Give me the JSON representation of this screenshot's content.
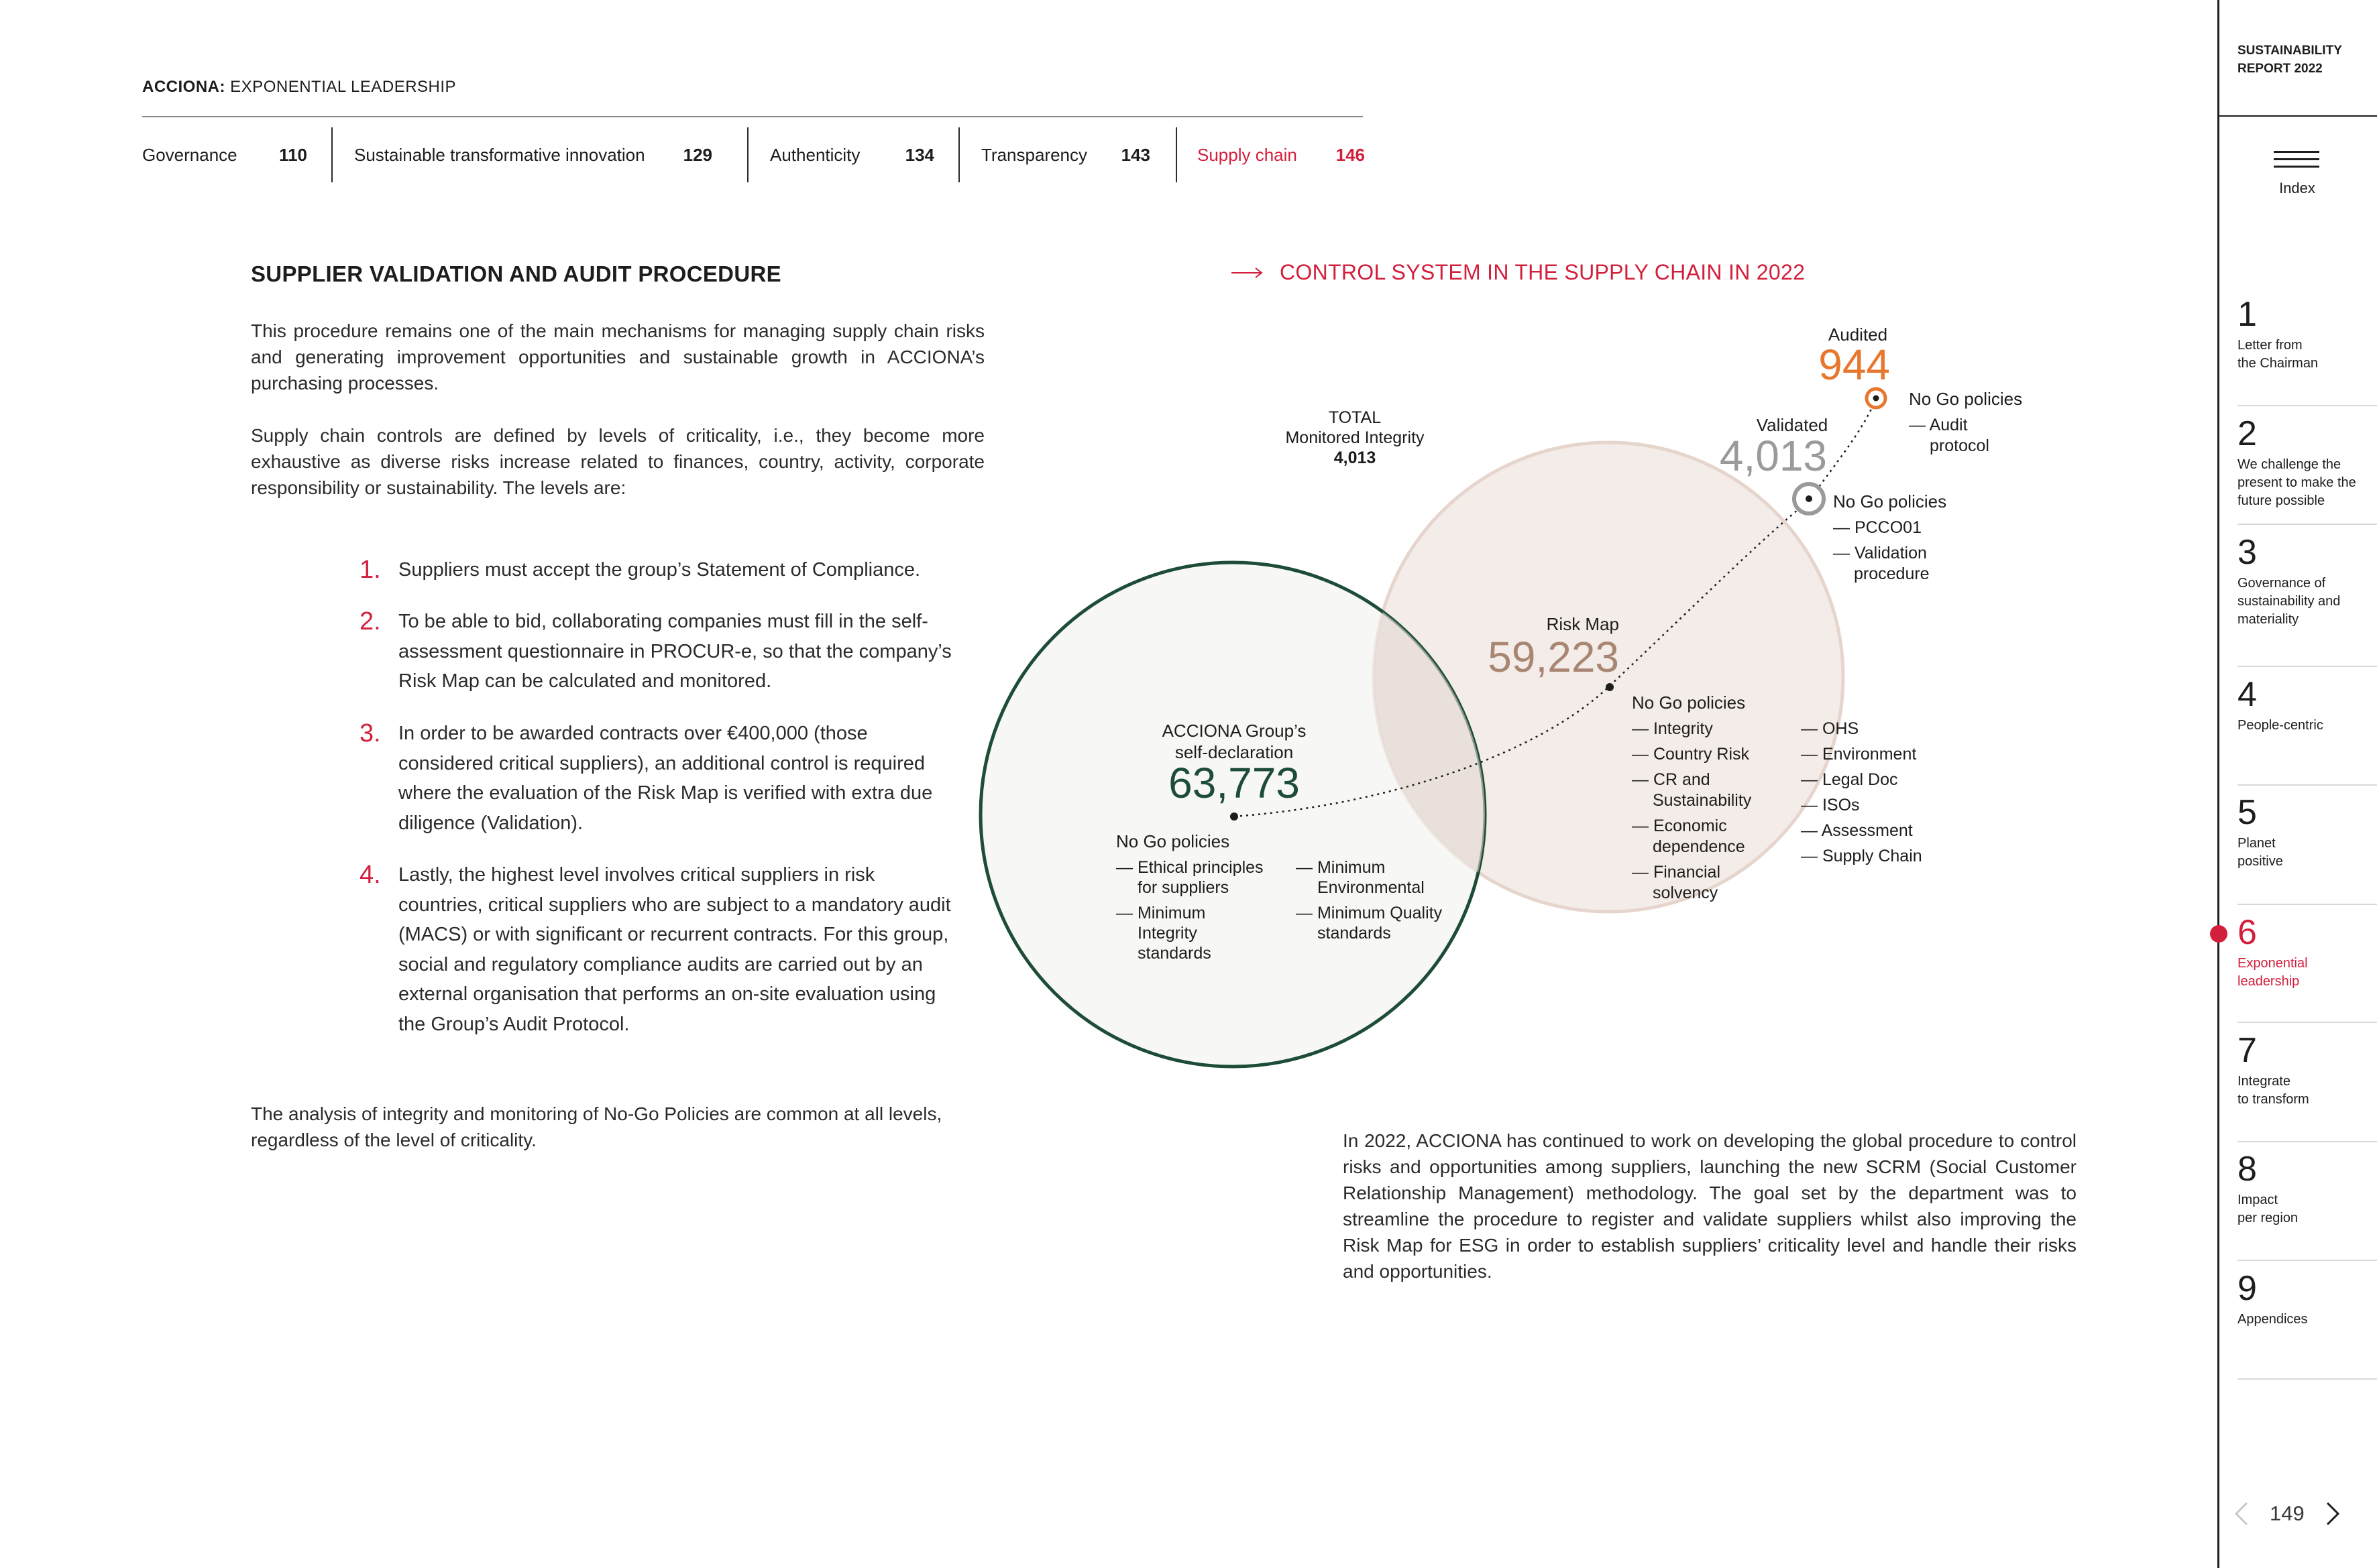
{
  "header": {
    "brand_bold": "ACCIONA:",
    "brand_rest": " EXPONENTIAL LEADERSHIP",
    "nav": [
      {
        "label": "Governance",
        "page": "110"
      },
      {
        "label": "Sustainable transformative innovation",
        "page": "129"
      },
      {
        "label": "Authenticity",
        "page": "134"
      },
      {
        "label": "Transparency",
        "page": "143"
      },
      {
        "label": "Supply chain",
        "page": "146"
      }
    ]
  },
  "left": {
    "heading": "SUPPLIER VALIDATION AND AUDIT PROCEDURE",
    "para1": "This procedure remains one of the main mechanisms for managing supply chain risks and generating improvement opportunities and sustainable growth in ACCIONA’s purchasing processes.",
    "para2": "Supply chain controls are defined by levels of criticality, i.e., they become more exhaustive as diverse risks increase related to finances, country, activity, corporate responsibility or sustainability. The levels are:",
    "levels": [
      {
        "num": "1.",
        "text": "Suppliers must accept the group’s Statement of Compliance."
      },
      {
        "num": "2.",
        "text": "To be able to bid, collaborating companies must fill in the self-assessment questionnaire in PROCUR-e, so that the company’s Risk Map can be calculated and monitored."
      },
      {
        "num": "3.",
        "text": "In order to be awarded contracts over €400,000 (those considered critical suppliers), an additional control is required where the evaluation of the Risk Map is verified with extra due diligence (Validation)."
      },
      {
        "num": "4.",
        "text": "Lastly, the highest level involves critical suppliers in risk countries, critical suppliers who are subject to a mandatory audit (MACS) or with significant or recurrent contracts. For this group, social and regulatory compliance audits are carried out by an external organisation that performs an on-site evaluation using the Group’s Audit Protocol."
      }
    ],
    "para3": "The analysis of integrity and monitoring of No-Go Policies are common at all levels, regardless of the level of criticality."
  },
  "chart": {
    "title": "CONTROL SYSTEM IN THE SUPPLY CHAIN IN 2022",
    "total_label": "TOTAL",
    "total_sub": "Monitored Integrity",
    "total_value": "4,013",
    "self_decl_line1": "ACCIONA Group’s",
    "self_decl_line2": "self-declaration",
    "self_decl_value": "63,773",
    "self_nogo_title": "No Go policies",
    "self_nogo_col1": [
      [
        "— Ethical principles",
        "for suppliers"
      ],
      [
        "— Minimum",
        "Integrity",
        "standards"
      ]
    ],
    "self_nogo_col2": [
      [
        "— Minimum",
        "Environmental"
      ],
      [
        "— Minimum Quality",
        "standards"
      ]
    ],
    "risk_label": "Risk Map",
    "risk_value": "59,223",
    "risk_nogo_title": "No Go policies",
    "risk_nogo_col1": [
      [
        "— Integrity"
      ],
      [
        "— Country Risk"
      ],
      [
        "— CR and",
        "Sustainability"
      ],
      [
        "— Economic",
        "dependence"
      ],
      [
        "— Financial",
        "solvency"
      ]
    ],
    "risk_nogo_col2": [
      [
        "— OHS"
      ],
      [
        "— Environment"
      ],
      [
        "— Legal Doc"
      ],
      [
        "— ISOs"
      ],
      [
        "— Assessment"
      ],
      [
        "— Supply Chain"
      ]
    ],
    "validated_label": "Validated",
    "validated_value": "4,013",
    "validated_nogo_title": "No Go policies",
    "validated_nogo": [
      [
        "— PCCO01"
      ],
      [
        "— Validation",
        "procedure"
      ]
    ],
    "audited_label": "Audited",
    "audited_value": "944",
    "audited_nogo_title": "No Go policies",
    "audited_nogo": [
      [
        "— Audit",
        "protocol"
      ]
    ],
    "colors": {
      "green": "#1e4d37",
      "beige": "#a88672",
      "grey": "#9a9a9a",
      "orange": "#e8772e",
      "red": "#d21f3c"
    }
  },
  "right": {
    "para": "In 2022, ACCIONA has continued to work on developing the global procedure to control risks and opportunities among suppliers, launching the new SCRM (Social Customer Relationship Management) methodology. The goal set by the department was to streamline the procedure to register and validate suppliers whilst also improving the Risk Map for ESG in order to establish suppliers’ criticality level and handle their risks and opportunities."
  },
  "sidebar": {
    "report_line1": "SUSTAINABILITY",
    "report_line2": "REPORT 2022",
    "index_label": "Index",
    "chapters": [
      {
        "num": "1",
        "lines": [
          "Letter from",
          "the Chairman"
        ]
      },
      {
        "num": "2",
        "lines": [
          "We challenge the",
          "present to make the",
          "future possible"
        ]
      },
      {
        "num": "3",
        "lines": [
          "Governance of",
          "sustainability and",
          "materiality"
        ]
      },
      {
        "num": "4",
        "lines": [
          "People-centric"
        ]
      },
      {
        "num": "5",
        "lines": [
          "Planet",
          "positive"
        ]
      },
      {
        "num": "6",
        "lines": [
          "Exponential",
          "leadership"
        ]
      },
      {
        "num": "7",
        "lines": [
          "Integrate",
          "to transform"
        ]
      },
      {
        "num": "8",
        "lines": [
          "Impact",
          "per region"
        ]
      },
      {
        "num": "9",
        "lines": [
          "Appendices"
        ]
      }
    ],
    "page_number": "149"
  }
}
